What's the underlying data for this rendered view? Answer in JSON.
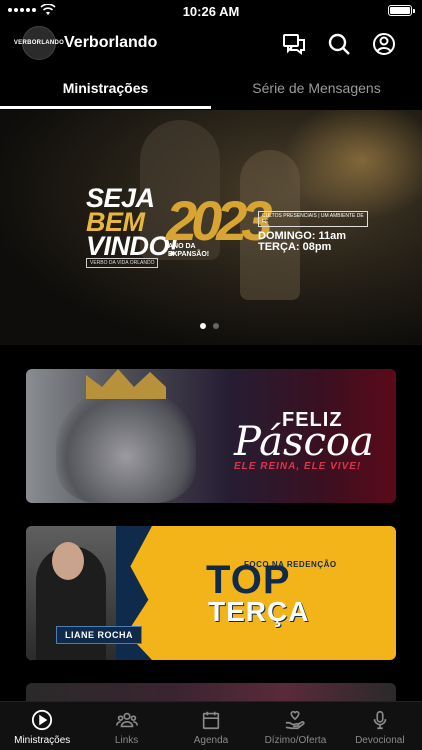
{
  "status_bar": {
    "time": "10:26 AM"
  },
  "app": {
    "title": "Verborlando",
    "logo_text": "VERBORLANDO"
  },
  "tabs": [
    {
      "label": "Ministrações",
      "active": true
    },
    {
      "label": "Série de Mensagens",
      "active": false
    }
  ],
  "hero": {
    "line1": "SEJA",
    "line2": "BEM",
    "line3": "VINDO!",
    "year": "2023",
    "year_caption": "ANO DA EXPANSÃO!",
    "social": "VERBO DA VIDA ORLANDO",
    "tagline": "CULTOS PRESENCIAIS | UM AMBIENTE DE FÉ",
    "schedule": [
      "DOMINGO: 11am",
      "TERÇA: 08pm"
    ],
    "slides": 2,
    "active_slide": 1
  },
  "cards": {
    "easter": {
      "feliz": "FELIZ",
      "pascoa": "Páscoa",
      "sub": "ELE REINA, ELE VIVE!"
    },
    "top_terca": {
      "foco": "FOCO NA REDENÇÃO",
      "top": "TOP",
      "terca": "TERÇA",
      "name": "LIANE ROCHA"
    }
  },
  "bottom_nav": [
    {
      "label": "Ministrações",
      "icon": "play-circle-icon",
      "active": true
    },
    {
      "label": "Links",
      "icon": "group-icon",
      "active": false
    },
    {
      "label": "Agenda",
      "icon": "calendar-icon",
      "active": false
    },
    {
      "label": "Dízimo/Oferta",
      "icon": "hand-heart-icon",
      "active": false
    },
    {
      "label": "Devocional",
      "icon": "microphone-icon",
      "active": false
    }
  ],
  "colors": {
    "accent": "#ffffff",
    "gold": "#d9a532",
    "background": "#000000",
    "inactive": "#8a8a8a"
  }
}
